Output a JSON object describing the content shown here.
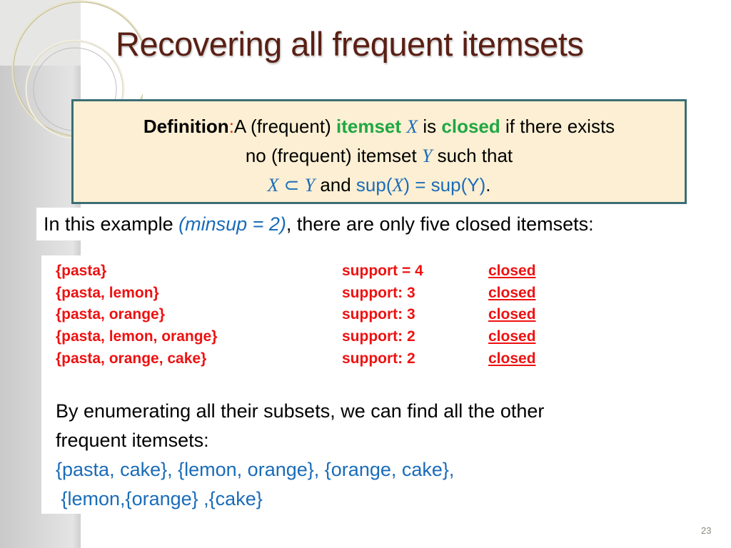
{
  "slide": {
    "title": "Recovering all frequent itemsets",
    "page_number": "23"
  },
  "definition": {
    "label": "Definition",
    "colon": ":",
    "line1_a": "A (frequent) ",
    "line1_itemset": "itemset",
    "line1_X": "X",
    "line1_is": " is ",
    "line1_closed": "closed",
    "line1_rest": " if there exists",
    "line2_a": "no (frequent) itemset ",
    "line2_Y": "Y",
    "line2_rest": " such that",
    "line3_X": "X",
    "line3_subset": " ⊂ ",
    "line3_Y": "Y",
    "line3_and": " and ",
    "line3_supX_a": "sup(",
    "line3_supX_X": "X",
    "line3_supX_b": ") = sup(Y)",
    "line3_period": "."
  },
  "example": {
    "prefix": "In this example ",
    "minsup": "(minsup = 2)",
    "suffix": ", there are only five closed itemsets:"
  },
  "closed_itemsets": [
    {
      "set": "{pasta}",
      "support": "support = 4",
      "status": "closed"
    },
    {
      "set": "{pasta, lemon}",
      "support": "support: 3",
      "status": "closed"
    },
    {
      "set": "{pasta, orange}",
      "support": "support: 3",
      "status": "closed"
    },
    {
      "set": "{pasta, lemon, orange}",
      "support": "support: 2",
      "status": "closed"
    },
    {
      "set": "{pasta, orange, cake}",
      "support": "support: 2",
      "status": "closed"
    }
  ],
  "enumeration": {
    "line1": "By enumerating all their subsets, we can find all the other",
    "line2": "frequent itemsets:",
    "line3": "{pasta, cake}, {lemon, orange}, {orange, cake},",
    "line4": " {lemon,{orange} ,{cake}"
  },
  "colors": {
    "title": "#5a1f14",
    "definition_bg": "#fdefd3",
    "definition_border": "#3b6e76",
    "green": "#1fa844",
    "blue": "#1a6cb8",
    "red": "#ee1111"
  }
}
